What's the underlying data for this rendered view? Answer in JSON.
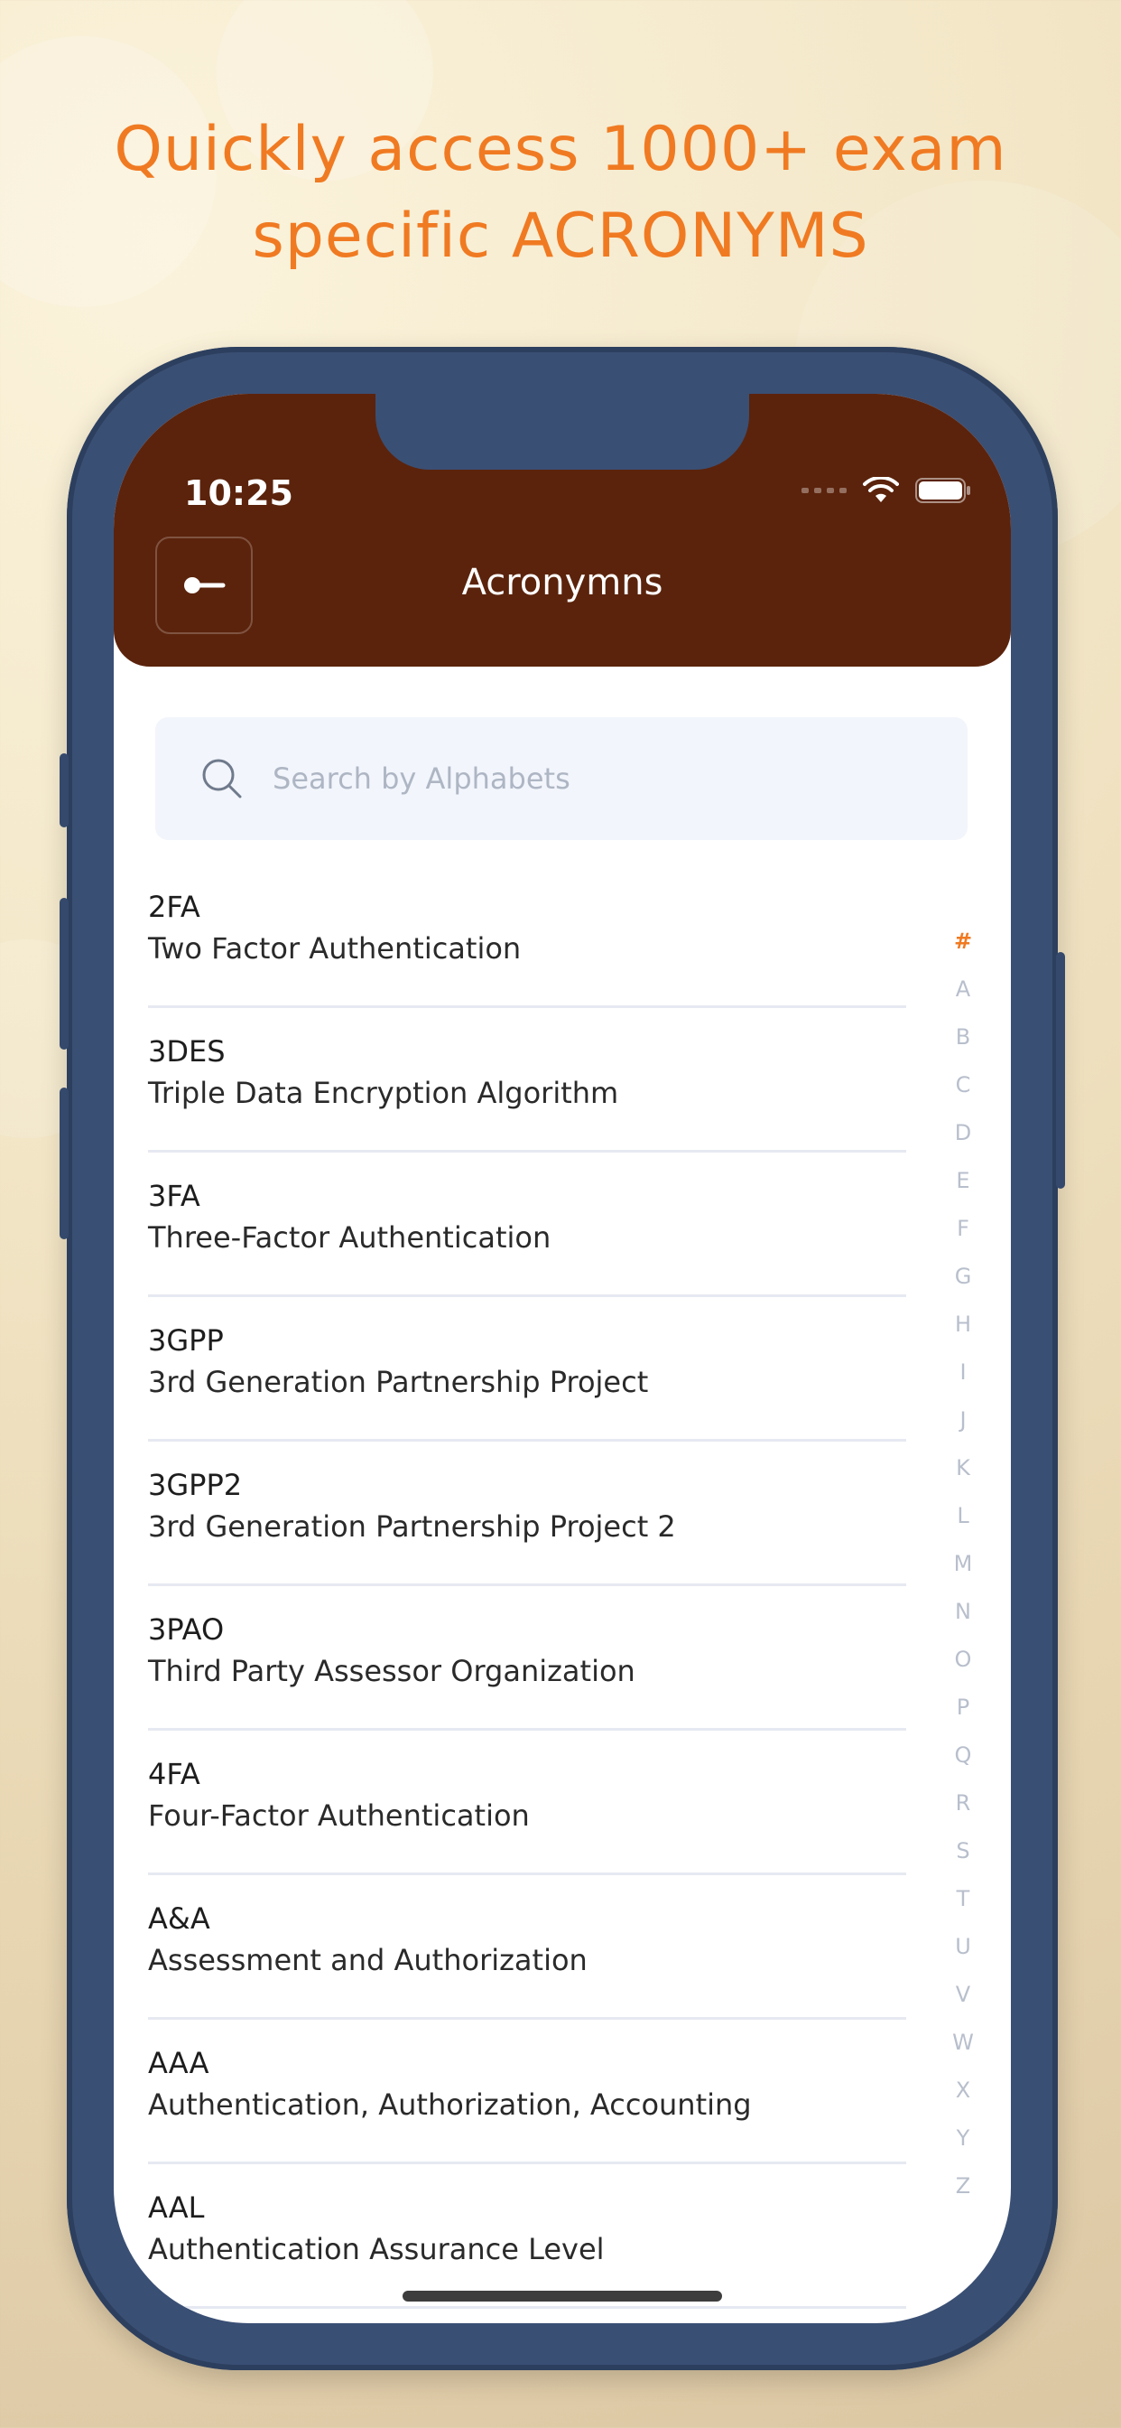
{
  "headline": {
    "line1": "Quickly access 1000+ exam",
    "line2": "specific ACRONYMS"
  },
  "status_bar": {
    "time": "10:25",
    "icons": [
      "signal-icon",
      "wifi-icon",
      "battery-icon"
    ]
  },
  "app_bar": {
    "title": "Acronymns",
    "back_icon": "back-arrow-icon"
  },
  "search": {
    "placeholder": "Search by Alphabets",
    "value": "",
    "icon": "search-icon"
  },
  "acronyms": [
    {
      "abbr": "2FA",
      "full": "Two Factor Authentication"
    },
    {
      "abbr": "3DES",
      "full": "Triple Data Encryption Algorithm"
    },
    {
      "abbr": "3FA",
      "full": "Three-Factor Authentication"
    },
    {
      "abbr": "3GPP",
      "full": "3rd Generation Partnership Project"
    },
    {
      "abbr": "3GPP2",
      "full": "3rd Generation Partnership Project 2"
    },
    {
      "abbr": "3PAO",
      "full": "Third Party Assessor Organization"
    },
    {
      "abbr": "4FA",
      "full": "Four-Factor Authentication"
    },
    {
      "abbr": "A&A",
      "full": "Assessment and Authorization"
    },
    {
      "abbr": "AAA",
      "full": "Authentication, Authorization, Accounting"
    },
    {
      "abbr": "AAL",
      "full": "Authentication Assurance Level"
    }
  ],
  "index_letters": [
    "#",
    "A",
    "B",
    "C",
    "D",
    "E",
    "F",
    "G",
    "H",
    "I",
    "J",
    "K",
    "L",
    "M",
    "N",
    "O",
    "P",
    "Q",
    "R",
    "S",
    "T",
    "U",
    "V",
    "W",
    "X",
    "Y",
    "Z"
  ],
  "index_active": "#",
  "colors": {
    "accent": "#f07a22",
    "app_bar": "#5b230c",
    "phone_frame": "#3a4f74"
  }
}
